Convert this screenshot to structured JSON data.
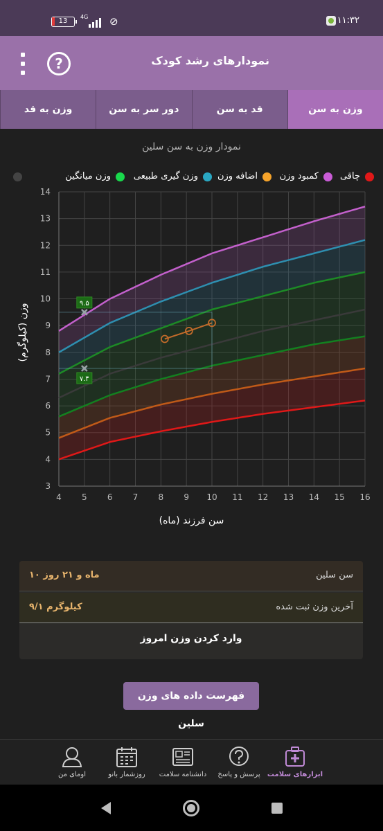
{
  "status_bar": {
    "time": "۱۱:۳۲",
    "battery": "13",
    "network": "4G"
  },
  "header": {
    "title": "نمودارهای رشد کودک"
  },
  "tabs": [
    {
      "label": "وزن به سن"
    },
    {
      "label": "قد به سن"
    },
    {
      "label": "دور سر به سن"
    },
    {
      "label": "وزن به قد"
    }
  ],
  "colors": {
    "header": "#9a71a9",
    "tab_active": "#a96fb8",
    "accent_value": "#e7b46d"
  },
  "chart_data": {
    "type": "line",
    "title": "نمودار وزن به سن سلین",
    "xlabel": "سن فرزند (ماه)",
    "ylabel": "وزن (کیلوگرم)",
    "xlim": [
      4,
      16
    ],
    "ylim": [
      3,
      14
    ],
    "x_ticks": [
      "4",
      "5",
      "6",
      "7",
      "8",
      "9",
      "10",
      "11",
      "12",
      "13",
      "14",
      "15",
      "16"
    ],
    "y_ticks": [
      "3",
      "4",
      "5",
      "6",
      "7",
      "8",
      "9",
      "10",
      "11",
      "12",
      "13",
      "14"
    ],
    "grid": true,
    "legend_position": "top",
    "legend": [
      {
        "name": "چاقی",
        "color": "#c95cd6"
      },
      {
        "name": "کمبود وزن",
        "color": "#f5a32a"
      },
      {
        "name": "اضافه وزن",
        "color": "#2aa7c2"
      },
      {
        "name": "وزن گیری طبیعی",
        "color": "#19d84c"
      },
      {
        "name": "وزن میانگین",
        "color": "#444444"
      }
    ],
    "curves": [
      {
        "name": "obesity",
        "color": "#c360cc",
        "x": [
          4,
          6,
          8,
          10,
          12,
          14,
          16
        ],
        "y": [
          8.8,
          10.0,
          10.9,
          11.7,
          12.3,
          12.9,
          13.45
        ]
      },
      {
        "name": "overweight",
        "color": "#2e8fb0",
        "x": [
          4,
          6,
          8,
          10,
          12,
          14,
          16
        ],
        "y": [
          8.0,
          9.1,
          9.9,
          10.6,
          11.2,
          11.7,
          12.2
        ]
      },
      {
        "name": "normal-upper",
        "color": "#1d8a26",
        "x": [
          4,
          6,
          8,
          10,
          12,
          14,
          16
        ],
        "y": [
          7.2,
          8.2,
          8.9,
          9.6,
          10.1,
          10.6,
          11.0
        ]
      },
      {
        "name": "average",
        "color": "#3a3a3a",
        "x": [
          4,
          6,
          8,
          10,
          12,
          14,
          16
        ],
        "y": [
          6.3,
          7.2,
          7.8,
          8.3,
          8.8,
          9.2,
          9.6
        ]
      },
      {
        "name": "normal-lower",
        "color": "#138020",
        "x": [
          4,
          6,
          8,
          10,
          12,
          14,
          16
        ],
        "y": [
          5.6,
          6.4,
          7.0,
          7.5,
          7.9,
          8.3,
          8.6
        ]
      },
      {
        "name": "underweight",
        "color": "#c05a18",
        "x": [
          4,
          6,
          8,
          10,
          12,
          14,
          16
        ],
        "y": [
          4.8,
          5.55,
          6.05,
          6.45,
          6.8,
          7.1,
          7.4
        ]
      },
      {
        "name": "severe-underweight",
        "color": "#e01818",
        "x": [
          4,
          6,
          8,
          10,
          12,
          14,
          16
        ],
        "y": [
          4.0,
          4.65,
          5.05,
          5.4,
          5.7,
          5.95,
          6.2
        ]
      }
    ],
    "child_series": {
      "name": "سلین",
      "color": "#c06a2a",
      "x": [
        8.15,
        9.1,
        10.0
      ],
      "y": [
        8.5,
        8.8,
        9.1
      ]
    },
    "markers": [
      {
        "x": 5,
        "y": 9.5,
        "label": "۹.۵"
      },
      {
        "x": 5,
        "y": 7.4,
        "label": "۷.۴"
      }
    ]
  },
  "info": {
    "age_label": "سن سلین",
    "age_value": "۱۰ ماه و ۲۱ روز",
    "weight_label": "آخرین وزن ثبت شده",
    "weight_value": "۹/۱ کیلوگرم",
    "enter_weight": "وارد کردن وزن امروز"
  },
  "data_list_button": "فهرست داده های وزن سلین",
  "bottom_nav": [
    {
      "label": "ابزارهای سلامت",
      "icon": "health-kit-icon",
      "active": true
    },
    {
      "label": "پرسش و پاسخ",
      "icon": "question-bubble-icon",
      "active": false
    },
    {
      "label": "دانشنامه سلامت",
      "icon": "newspaper-icon",
      "active": false
    },
    {
      "label": "روزشمار بانو",
      "icon": "calendar-icon",
      "active": false
    },
    {
      "label": "اومای من",
      "icon": "profile-icon",
      "active": false
    }
  ]
}
